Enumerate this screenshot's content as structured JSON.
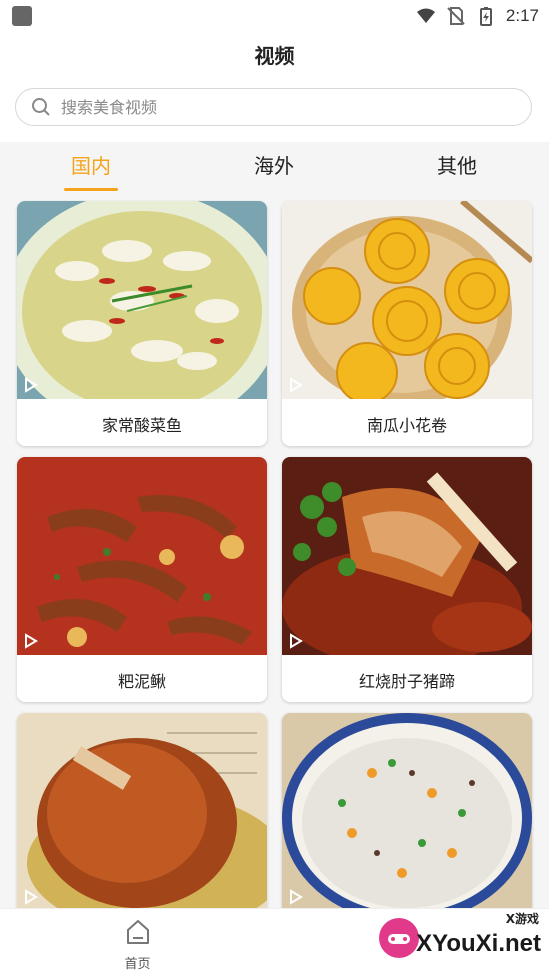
{
  "status_bar": {
    "time": "2:17"
  },
  "page": {
    "title": "视频"
  },
  "search": {
    "placeholder": "搜索美食视频"
  },
  "tabs": [
    {
      "label": "国内",
      "active": true
    },
    {
      "label": "海外",
      "active": false
    },
    {
      "label": "其他",
      "active": false
    }
  ],
  "colors": {
    "accent": "#f5a31a",
    "background": "#f5f5f5"
  },
  "videos": [
    {
      "title": "家常酸菜鱼"
    },
    {
      "title": "南瓜小花卷"
    },
    {
      "title": "粑泥鳅"
    },
    {
      "title": "红烧肘子猪蹄"
    },
    {
      "title": ""
    },
    {
      "title": ""
    }
  ],
  "bottom_nav": {
    "home_label": "首页"
  },
  "watermark": {
    "top": "X游戏",
    "brand": "XYouXi.net"
  }
}
